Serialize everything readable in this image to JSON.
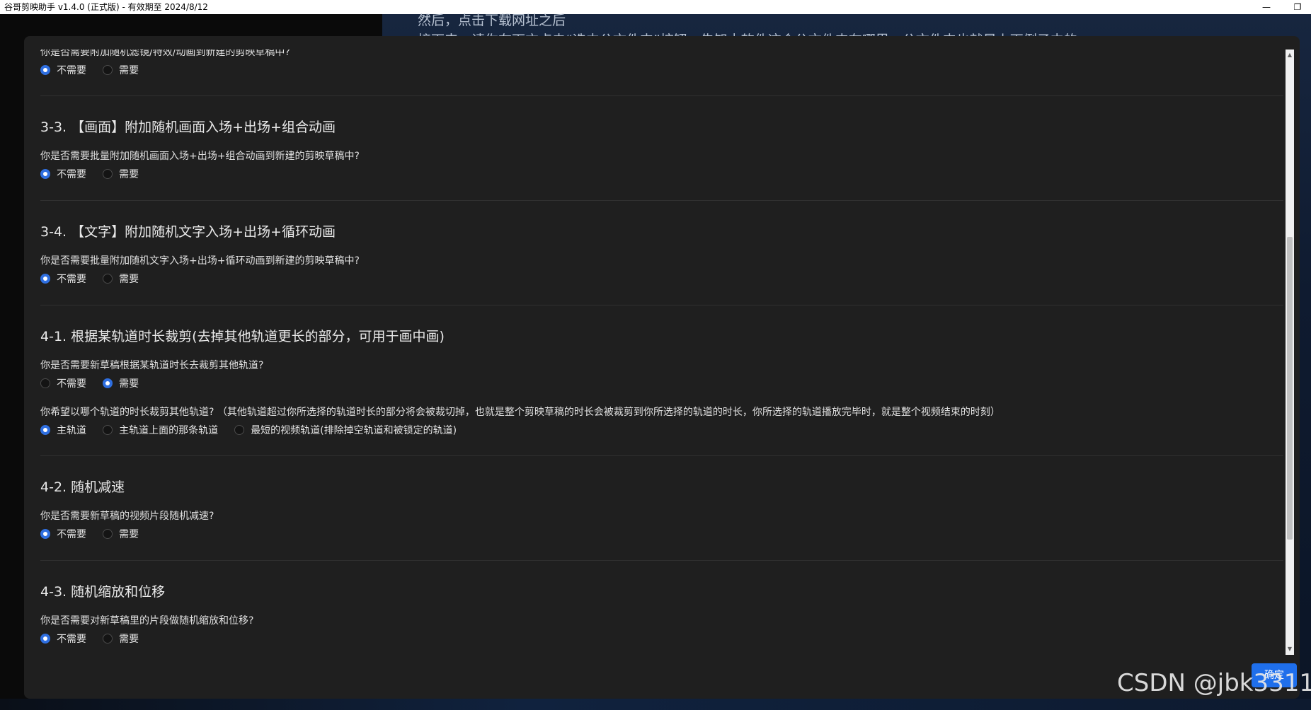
{
  "window": {
    "title": "谷哥剪映助手 v1.4.0 (正式版) - 有效期至 2024/8/12",
    "minimize_glyph": "—",
    "restore_glyph": "❐"
  },
  "background": {
    "line1": "然后，点击下载网址之后",
    "line2": "接下来，请你在下方点击“选中公文件夹”按钮，告知本软件这个公文件夹在哪里。公文件夹也就是上面例子中的……"
  },
  "top_partial": {
    "question": "你是否需要附加随机滤镜/特效/动画到新建的剪映草稿中?",
    "options": [
      {
        "label": "不需要",
        "checked": true
      },
      {
        "label": "需要",
        "checked": false
      }
    ]
  },
  "sections": [
    {
      "title": "3-3. 【画面】附加随机画面入场+出场+组合动画",
      "question": "你是否需要批量附加随机画面入场+出场+组合动画到新建的剪映草稿中?",
      "options": [
        {
          "label": "不需要",
          "checked": true
        },
        {
          "label": "需要",
          "checked": false
        }
      ]
    },
    {
      "title": "3-4. 【文字】附加随机文字入场+出场+循环动画",
      "question": "你是否需要批量附加随机文字入场+出场+循环动画到新建的剪映草稿中?",
      "options": [
        {
          "label": "不需要",
          "checked": true
        },
        {
          "label": "需要",
          "checked": false
        }
      ]
    },
    {
      "title": "4-1. 根据某轨道时长裁剪(去掉其他轨道更长的部分，可用于画中画)",
      "question": "你是否需要新草稿根据某轨道时长去裁剪其他轨道?",
      "options": [
        {
          "label": "不需要",
          "checked": false
        },
        {
          "label": "需要",
          "checked": true
        }
      ],
      "question2": "你希望以哪个轨道的时长裁剪其他轨道? （其他轨道超过你所选择的轨道时长的部分将会被裁切掉，也就是整个剪映草稿的时长会被裁剪到你所选择的轨道的时长，你所选择的轨道播放完毕时，就是整个视频结束的时刻）",
      "options2": [
        {
          "label": "主轨道",
          "checked": true
        },
        {
          "label": "主轨道上面的那条轨道",
          "checked": false
        },
        {
          "label": "最短的视频轨道(排除掉空轨道和被锁定的轨道)",
          "checked": false
        }
      ]
    },
    {
      "title": "4-2. 随机减速",
      "question": "你是否需要新草稿的视频片段随机减速?",
      "options": [
        {
          "label": "不需要",
          "checked": true
        },
        {
          "label": "需要",
          "checked": false
        }
      ]
    },
    {
      "title": "4-3. 随机缩放和位移",
      "question": "你是否需要对新草稿里的片段做随机缩放和位移?",
      "options": [
        {
          "label": "不需要",
          "checked": true
        },
        {
          "label": "需要",
          "checked": false
        }
      ]
    }
  ],
  "confirm_button": "确定",
  "watermark": "CSDN @jbk3311",
  "colors": {
    "accent": "#2f6fe0",
    "dialog_bg": "#1f1f1f",
    "text": "#e6e6e6"
  }
}
